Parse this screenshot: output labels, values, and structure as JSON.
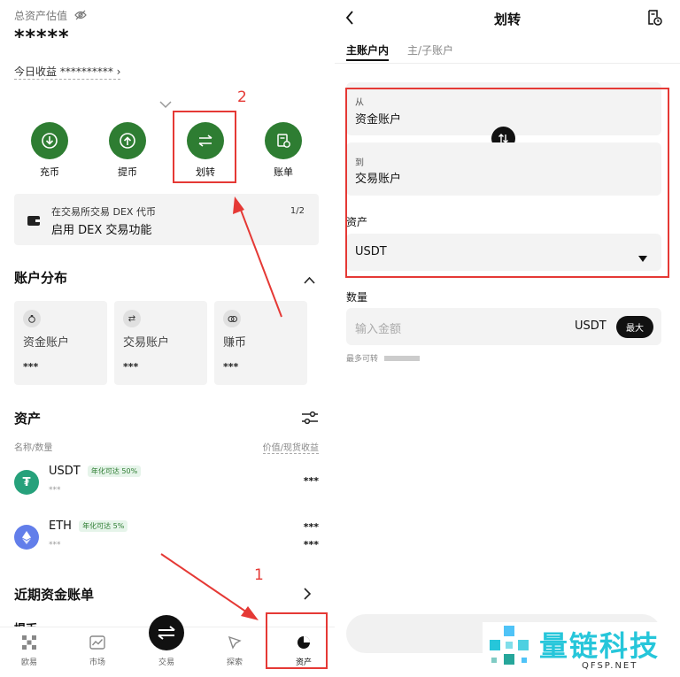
{
  "left": {
    "total_assets_label": "总资产估值",
    "total_assets_value": "*****",
    "today_earnings": "今日收益 **********",
    "actions": [
      {
        "label": "充币",
        "icon": "deposit-icon"
      },
      {
        "label": "提币",
        "icon": "withdraw-icon"
      },
      {
        "label": "划转",
        "icon": "transfer-icon"
      },
      {
        "label": "账单",
        "icon": "bill-icon"
      }
    ],
    "banner": {
      "line1": "在交易所交易 DEX 代币",
      "line2": "启用 DEX 交易功能",
      "pager": "1/2"
    },
    "account_distribution": {
      "title": "账户分布",
      "cards": [
        {
          "name": "资金账户",
          "value": "***"
        },
        {
          "name": "交易账户",
          "value": "***"
        },
        {
          "name": "赚币",
          "value": "***"
        }
      ]
    },
    "assets": {
      "title": "资产",
      "col_left": "名称/数量",
      "col_right": "价值/现货收益",
      "rows": [
        {
          "symbol": "USDT",
          "badge": "年化可达 50%",
          "amount": "***",
          "value": "***",
          "pnl": ""
        },
        {
          "symbol": "ETH",
          "badge": "年化可达 5%",
          "amount": "***",
          "value": "***",
          "pnl": "***"
        }
      ]
    },
    "recent_bills": "近期资金账单",
    "partial_text": "提币",
    "tabs": [
      {
        "label": "欧易",
        "icon": "okx-logo-icon"
      },
      {
        "label": "市场",
        "icon": "chart-icon"
      },
      {
        "label": "交易",
        "icon": "trade-icon"
      },
      {
        "label": "探索",
        "icon": "explore-icon"
      },
      {
        "label": "资产",
        "icon": "pie-icon"
      }
    ],
    "annotations": {
      "step1": "1",
      "step2": "2"
    }
  },
  "right": {
    "title": "划转",
    "subtabs": [
      "主账户内",
      "主/子账户"
    ],
    "from_label": "从",
    "from_value": "资金账户",
    "to_label": "到",
    "to_value": "交易账户",
    "asset_label": "资产",
    "asset_value": "USDT",
    "amount_label": "数量",
    "amount_placeholder": "输入金额",
    "amount_unit": "USDT",
    "max_label": "最大",
    "max_transferable": "最多可转",
    "watermark": {
      "title": "量链科技",
      "url": "QFSP.NET"
    }
  },
  "colors": {
    "accent_green": "#2e7d32",
    "annotation_red": "#e53935"
  }
}
